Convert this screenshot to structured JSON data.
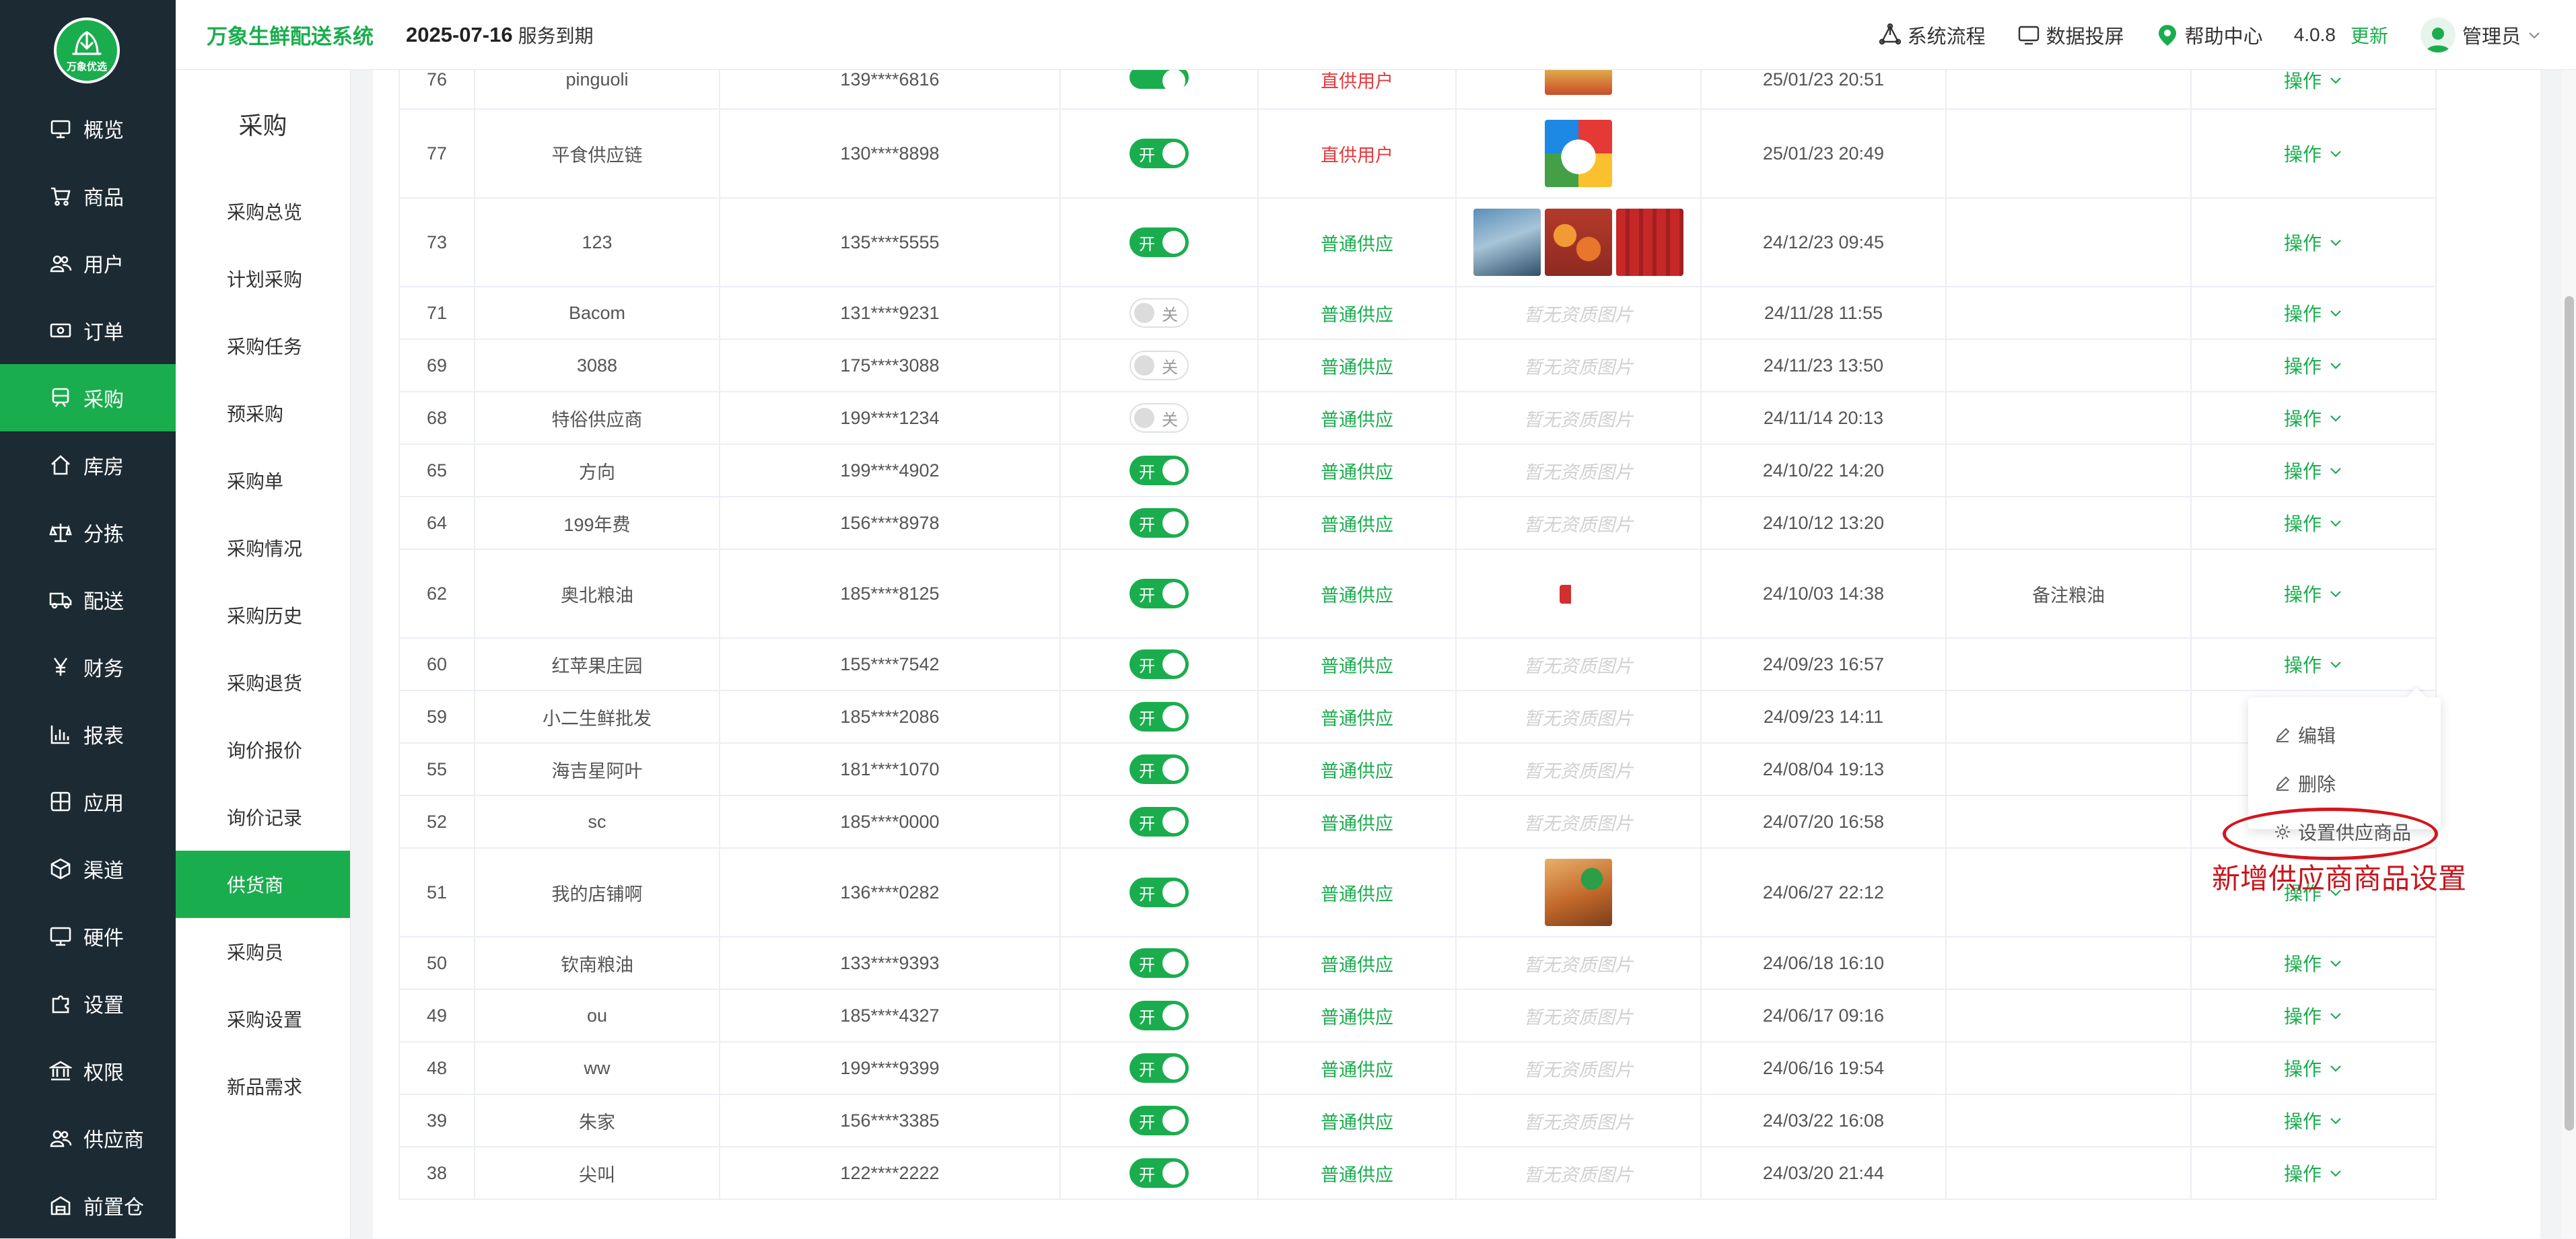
{
  "nav": {
    "logo_text": "万象优选",
    "items": [
      {
        "label": "概览",
        "icon": "monitor-icon"
      },
      {
        "label": "商品",
        "icon": "cart-icon"
      },
      {
        "label": "用户",
        "icon": "users-icon"
      },
      {
        "label": "订单",
        "icon": "money-icon"
      },
      {
        "label": "采购",
        "icon": "purchase-icon",
        "active": true
      },
      {
        "label": "库房",
        "icon": "home-icon"
      },
      {
        "label": "分拣",
        "icon": "scale-icon"
      },
      {
        "label": "配送",
        "icon": "truck-icon"
      },
      {
        "label": "财务",
        "icon": "yen-icon"
      },
      {
        "label": "报表",
        "icon": "bar-chart-icon"
      },
      {
        "label": "应用",
        "icon": "apps-icon"
      },
      {
        "label": "渠道",
        "icon": "cube-icon"
      },
      {
        "label": "硬件",
        "icon": "desktop-icon"
      },
      {
        "label": "设置",
        "icon": "puzzle-icon"
      },
      {
        "label": "权限",
        "icon": "bank-icon"
      },
      {
        "label": "供应商",
        "icon": "supplier-icon"
      },
      {
        "label": "前置仓",
        "icon": "warehouse-icon"
      }
    ]
  },
  "header": {
    "brand": "万象生鲜配送系统",
    "expire_date": "2025-07-16",
    "expire_text": "服务到期",
    "links": {
      "flow": "系统流程",
      "screen": "数据投屏",
      "help": "帮助中心"
    },
    "version": "4.0.8",
    "update": "更新",
    "user": "管理员"
  },
  "subnav": {
    "title": "采购",
    "items": [
      "采购总览",
      "计划采购",
      "采购任务",
      "预采购",
      "采购单",
      "采购情况",
      "采购历史",
      "采购退货",
      "询价报价",
      "询价记录",
      "供货商",
      "采购员",
      "采购设置",
      "新品需求"
    ],
    "active_index": 10
  },
  "table": {
    "partial_row": {
      "id": "76",
      "name": "pinguoli",
      "phone": "139****6816",
      "supply": "直供用户",
      "date": "25/01/23 20:51"
    },
    "rows": [
      {
        "id": "77",
        "name": "平食供应链",
        "phone": "130****8898",
        "enabled": true,
        "on": "开",
        "supply": "直供用户",
        "images": [
          "brand-logo"
        ],
        "date": "25/01/23 20:49",
        "note": "",
        "op": "操作"
      },
      {
        "id": "73",
        "name": "123",
        "phone": "135****5555",
        "enabled": true,
        "on": "开",
        "supply": "普通供应",
        "images": [
          "product-card",
          "fruit-basket",
          "red-crates"
        ],
        "date": "24/12/23 09:45",
        "note": "",
        "op": "操作"
      },
      {
        "id": "71",
        "name": "Bacom",
        "phone": "131****9231",
        "enabled": false,
        "off": "关",
        "supply": "普通供应",
        "noimg": "暂无资质图片",
        "date": "24/11/28 11:55",
        "note": "",
        "op": "操作"
      },
      {
        "id": "69",
        "name": "3088",
        "phone": "175****3088",
        "enabled": false,
        "off": "关",
        "supply": "普通供应",
        "noimg": "暂无资质图片",
        "date": "24/11/23 13:50",
        "note": "",
        "op": "操作"
      },
      {
        "id": "68",
        "name": "特俗供应商",
        "phone": "199****1234",
        "enabled": false,
        "off": "关",
        "supply": "普通供应",
        "noimg": "暂无资质图片",
        "date": "24/11/14 20:13",
        "note": "",
        "op": "操作"
      },
      {
        "id": "65",
        "name": "方向",
        "phone": "199****4902",
        "enabled": true,
        "on": "开",
        "supply": "普通供应",
        "noimg": "暂无资质图片",
        "date": "24/10/22 14:20",
        "note": "",
        "op": "操作"
      },
      {
        "id": "64",
        "name": "199年费",
        "phone": "156****8978",
        "enabled": true,
        "on": "开",
        "supply": "普通供应",
        "noimg": "暂无资质图片",
        "date": "24/10/12 13:20",
        "note": "",
        "op": "操作"
      },
      {
        "id": "62",
        "name": "奥北粮油",
        "phone": "185****8125",
        "enabled": true,
        "on": "开",
        "supply": "普通供应",
        "images": [
          "small-logo"
        ],
        "date": "24/10/03 14:38",
        "note": "备注粮油",
        "op": "操作"
      },
      {
        "id": "60",
        "name": "红苹果庄园",
        "phone": "155****7542",
        "enabled": true,
        "on": "开",
        "supply": "普通供应",
        "noimg": "暂无资质图片",
        "date": "24/09/23 16:57",
        "note": "",
        "op": "操作"
      },
      {
        "id": "59",
        "name": "小二生鲜批发",
        "phone": "185****2086",
        "enabled": true,
        "on": "开",
        "supply": "普通供应",
        "noimg": "暂无资质图片",
        "date": "24/09/23 14:11",
        "note": "",
        "op": ""
      },
      {
        "id": "55",
        "name": "海吉星阿叶",
        "phone": "181****1070",
        "enabled": true,
        "on": "开",
        "supply": "普通供应",
        "noimg": "暂无资质图片",
        "date": "24/08/04 19:13",
        "note": "",
        "op": ""
      },
      {
        "id": "52",
        "name": "sc",
        "phone": "185****0000",
        "enabled": true,
        "on": "开",
        "supply": "普通供应",
        "noimg": "暂无资质图片",
        "date": "24/07/20 16:58",
        "note": "",
        "op": ""
      },
      {
        "id": "51",
        "name": "我的店铺啊",
        "phone": "136****0282",
        "enabled": true,
        "on": "开",
        "supply": "普通供应",
        "images": [
          "food-photo"
        ],
        "date": "24/06/27 22:12",
        "note": "",
        "op": "操作"
      },
      {
        "id": "50",
        "name": "钦南粮油",
        "phone": "133****9393",
        "enabled": true,
        "on": "开",
        "supply": "普通供应",
        "noimg": "暂无资质图片",
        "date": "24/06/18 16:10",
        "note": "",
        "op": "操作"
      },
      {
        "id": "49",
        "name": "ou",
        "phone": "185****4327",
        "enabled": true,
        "on": "开",
        "supply": "普通供应",
        "noimg": "暂无资质图片",
        "date": "24/06/17 09:16",
        "note": "",
        "op": "操作"
      },
      {
        "id": "48",
        "name": "ww",
        "phone": "199****9399",
        "enabled": true,
        "on": "开",
        "supply": "普通供应",
        "noimg": "暂无资质图片",
        "date": "24/06/16 19:54",
        "note": "",
        "op": "操作"
      },
      {
        "id": "39",
        "name": "朱家",
        "phone": "156****3385",
        "enabled": true,
        "on": "开",
        "supply": "普通供应",
        "noimg": "暂无资质图片",
        "date": "24/03/22 16:08",
        "note": "",
        "op": "操作"
      },
      {
        "id": "38",
        "name": "尖叫",
        "phone": "122****2222",
        "enabled": true,
        "on": "开",
        "supply": "普通供应",
        "noimg": "暂无资质图片",
        "date": "24/03/20 21:44",
        "note": "",
        "op": "操作"
      }
    ]
  },
  "dropdown": {
    "edit": "编辑",
    "delete": "删除",
    "set_goods": "设置供应商品"
  },
  "annotation": "新增供应商商品设置",
  "colors": {
    "primary": "#1aad4e",
    "nav_bg": "#1c2a33",
    "direct_supply": "#e4393c",
    "annotation": "#c8161d"
  }
}
